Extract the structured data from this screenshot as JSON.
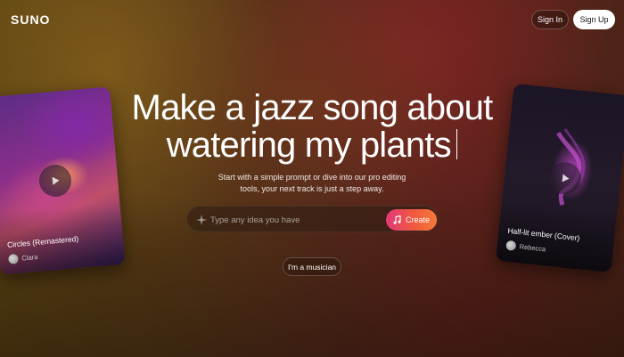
{
  "header": {
    "logo": "SUNO",
    "sign_in_label": "Sign In",
    "sign_up_label": "Sign Up"
  },
  "hero": {
    "headline_line1": "Make a jazz song about",
    "headline_line2": "watering my plants",
    "subtext_line1": "Start with a simple prompt or dive into our pro editing",
    "subtext_line2": "tools, your next track is just a step away.",
    "prompt_placeholder": "Type any idea you have",
    "prompt_value": "",
    "create_label": "Create",
    "musician_label": "I'm a musician"
  },
  "cards": {
    "left": {
      "title": "Circles (Remastered)",
      "artist": "Clara"
    },
    "right": {
      "title": "Half-lit ember (Cover)",
      "artist": "Rebecca"
    }
  },
  "colors": {
    "create_gradient_start": "#e2387a",
    "create_gradient_end": "#f47a3a",
    "sign_up_bg": "#ffffff"
  },
  "icons": {
    "prompt": "sparkle-icon",
    "create": "music-note-icon",
    "card_play": "play-icon"
  }
}
